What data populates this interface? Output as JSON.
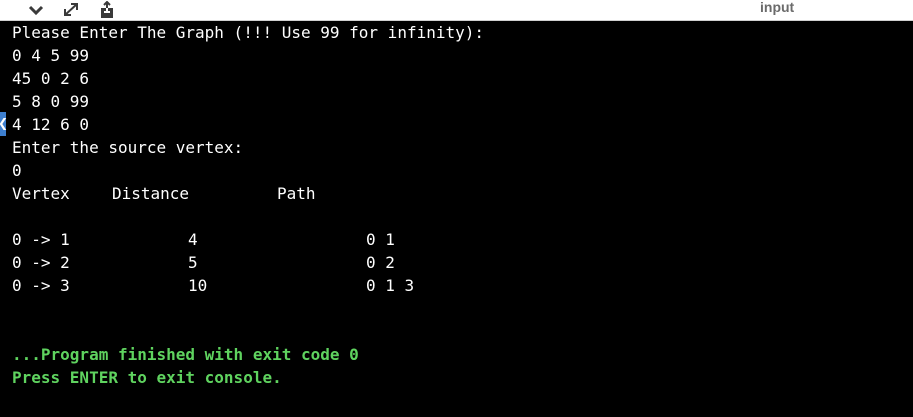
{
  "toolbar": {
    "icons": [
      "chevron-down-icon",
      "expand-icon",
      "upload-icon"
    ],
    "tab_label": "input"
  },
  "side_tab": {
    "icon": "chevron-left-icon",
    "glyph": "❮"
  },
  "console": {
    "prompt_graph": "Please Enter The Graph (!!! Use 99 for infinity):",
    "matrix_rows": [
      "0 4 5 99",
      "45 0 2 6",
      "5 8 0 99",
      "4 12 6 0"
    ],
    "prompt_source": "Enter the source vertex:",
    "source_input": "0",
    "table_headers": {
      "vertex": "Vertex",
      "distance": "Distance",
      "path": "Path"
    },
    "results": [
      {
        "vertex": "0 -> 1",
        "distance": "4",
        "path": "0 1"
      },
      {
        "vertex": "0 -> 2",
        "distance": "5",
        "path": "0 2"
      },
      {
        "vertex": "0 -> 3",
        "distance": "10",
        "path": "0 1 3"
      }
    ],
    "finish_message": "...Program finished with exit code 0",
    "exit_message": "Press ENTER to exit console."
  },
  "colors": {
    "background": "#000000",
    "text": "#ffffff",
    "status_text": "#5fd35f",
    "toolbar": "#ffffff",
    "side_tab": "#3d7fcf"
  }
}
